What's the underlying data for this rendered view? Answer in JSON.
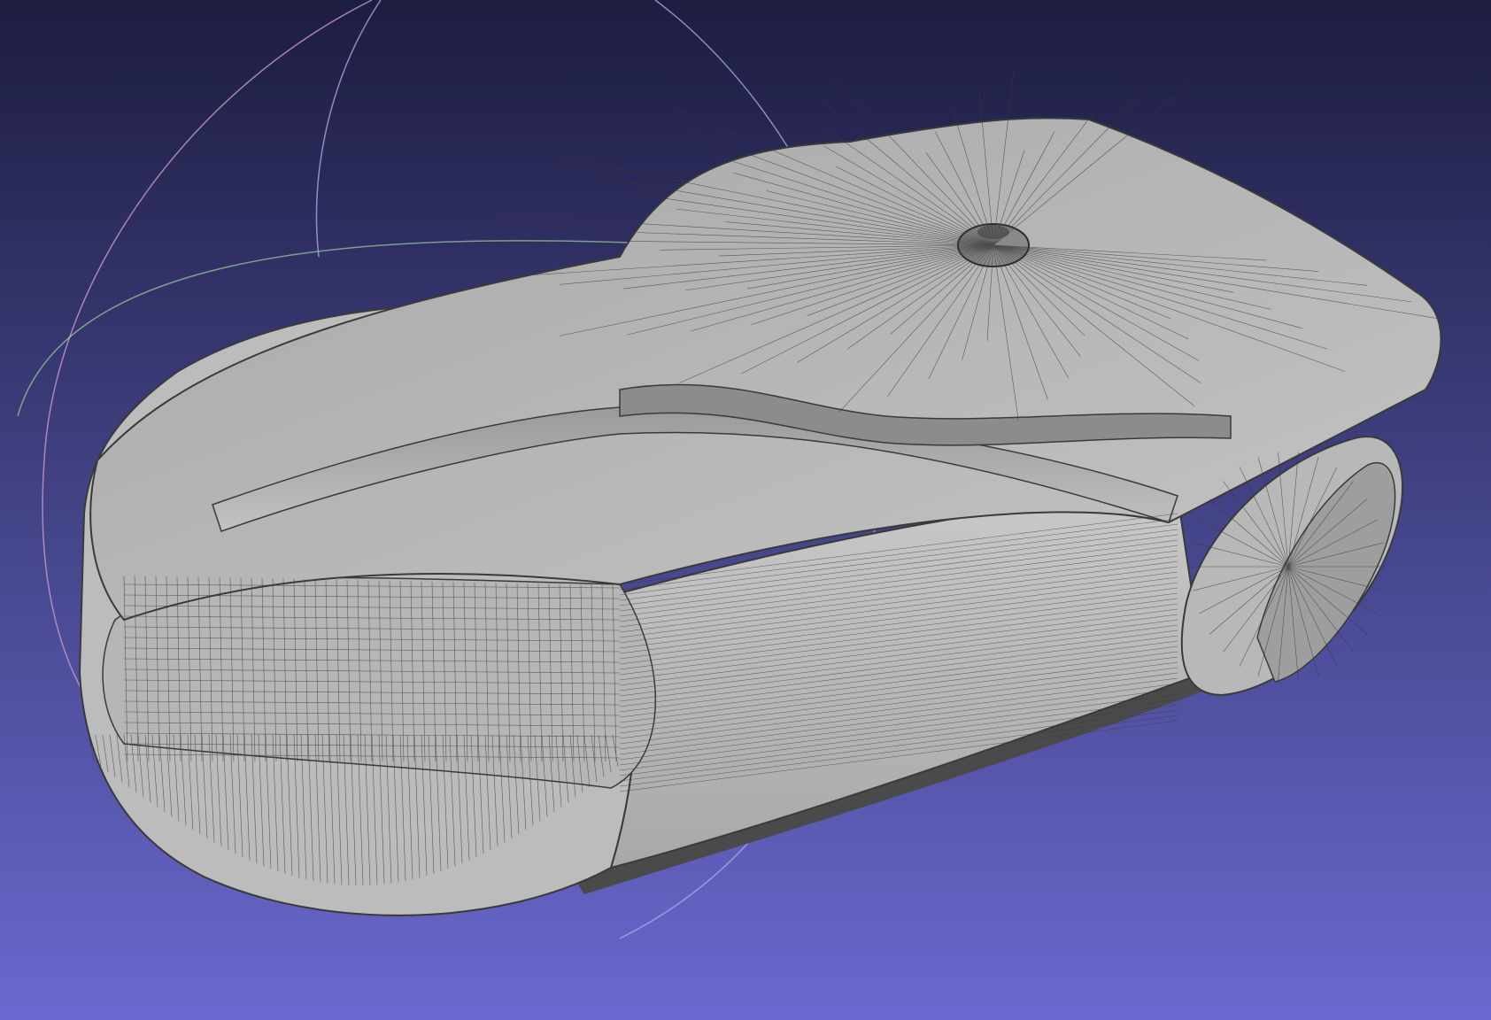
{
  "app": {
    "title": ""
  },
  "viewport": {
    "background_top": "#1c1d3f",
    "background_bottom": "#6a69cf",
    "mesh_fill": "#bdbdbd",
    "mesh_shade": "#9c9c9c",
    "wire_color": "#3a3a3a",
    "render_mode": "wireframe-over-flat",
    "trackball": {
      "visible": true,
      "ring_colors": [
        "#c99ac9",
        "#a9a9e6",
        "#9fcf9f"
      ]
    }
  }
}
